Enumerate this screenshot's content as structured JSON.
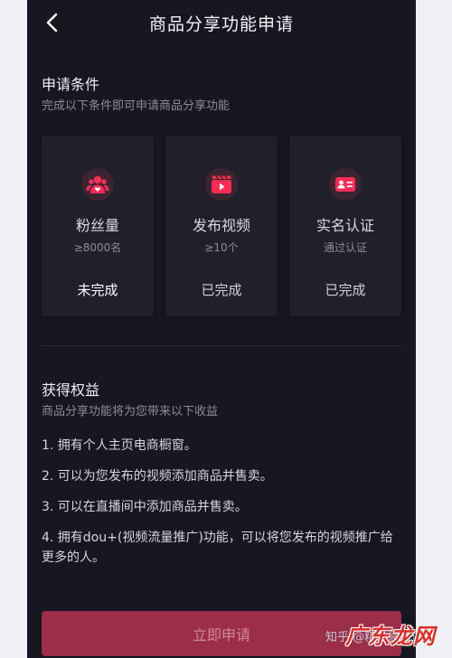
{
  "header": {
    "title": "商品分享功能申请"
  },
  "conditions": {
    "title": "申请条件",
    "subtitle": "完成以下条件即可申请商品分享功能",
    "cards": [
      {
        "icon": "fans-icon",
        "name": "粉丝量",
        "requirement": "≥8000名",
        "status": "未完成"
      },
      {
        "icon": "video-icon",
        "name": "发布视频",
        "requirement": "≥10个",
        "status": "已完成"
      },
      {
        "icon": "id-card-icon",
        "name": "实名认证",
        "requirement": "通过认证",
        "status": "已完成"
      }
    ]
  },
  "benefits": {
    "title": "获得权益",
    "subtitle": "商品分享功能将为您带来以下收益",
    "items": [
      "1. 拥有个人主页电商橱窗。",
      "2. 可以为您发布的视频添加商品并售卖。",
      "3. 可以在直播间中添加商品并售卖。",
      "4. 拥有dou+(视频流量推广)功能，可以将您发布的视频推广给更多的人。"
    ]
  },
  "apply_button": {
    "label": "立即申请"
  },
  "watermark": {
    "text": "知乎 @精木俪社俊者",
    "logo": "广东龙网"
  },
  "colors": {
    "background": "#161722",
    "card": "#1f202c",
    "accent": "#fe2c55",
    "button": "#9c2e49",
    "status_done": "#d0d0d6",
    "status_pending": "#ffffff"
  }
}
